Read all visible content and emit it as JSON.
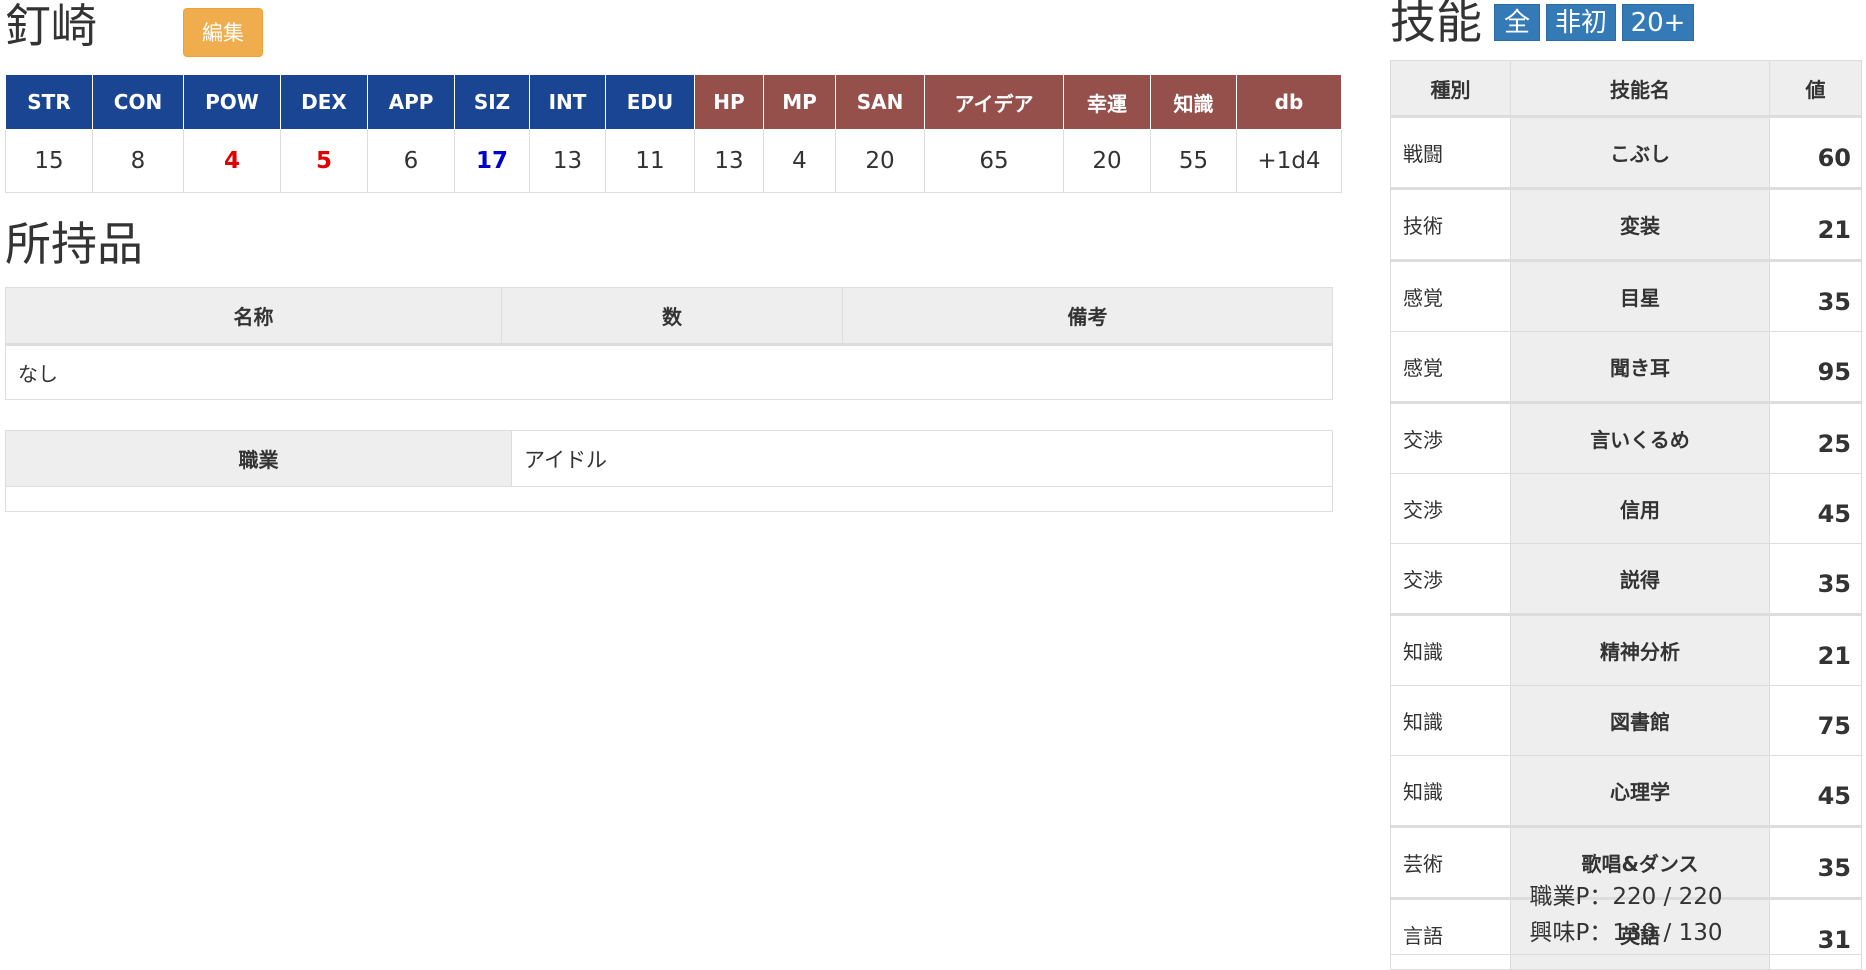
{
  "character": {
    "name": "釘崎",
    "edit_label": "編集"
  },
  "stats": {
    "headers": [
      {
        "label": "STR",
        "group": "b"
      },
      {
        "label": "CON",
        "group": "b"
      },
      {
        "label": "POW",
        "group": "b"
      },
      {
        "label": "DEX",
        "group": "b"
      },
      {
        "label": "APP",
        "group": "b"
      },
      {
        "label": "SIZ",
        "group": "b"
      },
      {
        "label": "INT",
        "group": "b"
      },
      {
        "label": "EDU",
        "group": "b"
      },
      {
        "label": "HP",
        "group": "r"
      },
      {
        "label": "MP",
        "group": "r"
      },
      {
        "label": "SAN",
        "group": "r"
      },
      {
        "label": "アイデア",
        "group": "r"
      },
      {
        "label": "幸運",
        "group": "r"
      },
      {
        "label": "知識",
        "group": "r"
      },
      {
        "label": "db",
        "group": "r"
      }
    ],
    "values": [
      {
        "v": "15",
        "mark": ""
      },
      {
        "v": "8",
        "mark": ""
      },
      {
        "v": "4",
        "mark": "low"
      },
      {
        "v": "5",
        "mark": "low"
      },
      {
        "v": "6",
        "mark": ""
      },
      {
        "v": "17",
        "mark": "high"
      },
      {
        "v": "13",
        "mark": ""
      },
      {
        "v": "11",
        "mark": ""
      },
      {
        "v": "13",
        "mark": ""
      },
      {
        "v": "4",
        "mark": ""
      },
      {
        "v": "20",
        "mark": ""
      },
      {
        "v": "65",
        "mark": ""
      },
      {
        "v": "20",
        "mark": ""
      },
      {
        "v": "55",
        "mark": ""
      },
      {
        "v": "+1d4",
        "mark": ""
      }
    ],
    "colors": {
      "primary": "#1a4593",
      "derived": "#96504b",
      "low": "#e00000",
      "high": "#0000cc"
    }
  },
  "inventory": {
    "title": "所持品",
    "headers": [
      "名称",
      "数",
      "備考"
    ],
    "empty_text": "なし"
  },
  "occupation": {
    "label": "職業",
    "value": "アイドル"
  },
  "skills": {
    "title": "技能",
    "filters": [
      "全",
      "非初",
      "20+"
    ],
    "headers": [
      "種別",
      "技能名",
      "値"
    ],
    "rows": [
      {
        "cat": "戦闘",
        "name": "こぶし",
        "val": "60",
        "grp": true
      },
      {
        "cat": "技術",
        "name": "変装",
        "val": "21",
        "grp": true
      },
      {
        "cat": "感覚",
        "name": "目星",
        "val": "35",
        "grp": true
      },
      {
        "cat": "感覚",
        "name": "聞き耳",
        "val": "95",
        "grp": false
      },
      {
        "cat": "交渉",
        "name": "言いくるめ",
        "val": "25",
        "grp": true
      },
      {
        "cat": "交渉",
        "name": "信用",
        "val": "45",
        "grp": false
      },
      {
        "cat": "交渉",
        "name": "説得",
        "val": "35",
        "grp": false
      },
      {
        "cat": "知識",
        "name": "精神分析",
        "val": "21",
        "grp": true
      },
      {
        "cat": "知識",
        "name": "図書館",
        "val": "75",
        "grp": false
      },
      {
        "cat": "知識",
        "name": "心理学",
        "val": "45",
        "grp": false
      },
      {
        "cat": "芸術",
        "name": "歌唱&ダンス",
        "val": "35",
        "grp": true
      },
      {
        "cat": "言語",
        "name": "英語",
        "val": "31",
        "grp": true
      }
    ],
    "occupation_points": "職業P：220 / 220",
    "interest_points": "興味P：130 / 130"
  }
}
